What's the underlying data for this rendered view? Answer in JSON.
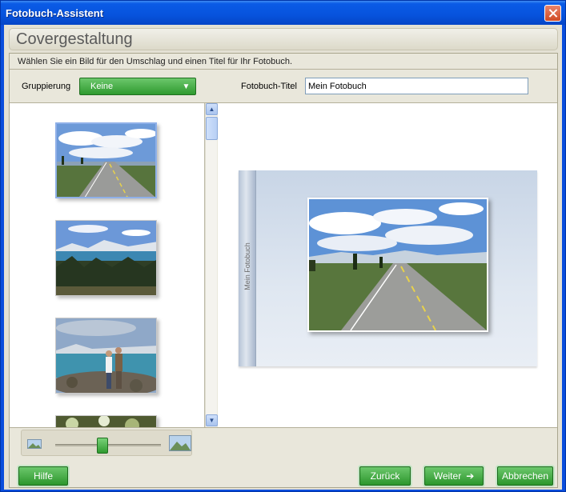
{
  "window": {
    "title": "Fotobuch-Assistent"
  },
  "header": {
    "page_title": "Covergestaltung"
  },
  "main": {
    "instructions": "Wählen Sie ein Bild für den Umschlag und einen Titel für Ihr Fotobuch.",
    "grouping_label": "Gruppierung",
    "grouping_value": "Keine",
    "title_label": "Fotobuch-Titel",
    "title_value": "Mein Fotobuch"
  },
  "thumbnails": [
    {
      "subject": "road through grassland",
      "selected": true
    },
    {
      "subject": "lake with mountains",
      "selected": false
    },
    {
      "subject": "couple by the lake",
      "selected": false
    },
    {
      "subject": "vegetation",
      "selected": false
    }
  ],
  "preview": {
    "spine_text": "Mein Fotobuch"
  },
  "zoom": {
    "level": 0.45
  },
  "footer": {
    "help_label": "Hilfe",
    "back_label": "Zurück",
    "next_label": "Weiter",
    "cancel_label": "Abbrechen"
  },
  "icons": {
    "close": "close-icon",
    "dropdown": "chevron-down-icon",
    "next_arrow": "arrow-right-icon",
    "zoom_out": "small-image-icon",
    "zoom_in": "large-image-icon"
  },
  "colors": {
    "titlebar": "#0753dd",
    "accent_green": "#2f9a2f",
    "panel_bg": "#e4e1d4"
  }
}
